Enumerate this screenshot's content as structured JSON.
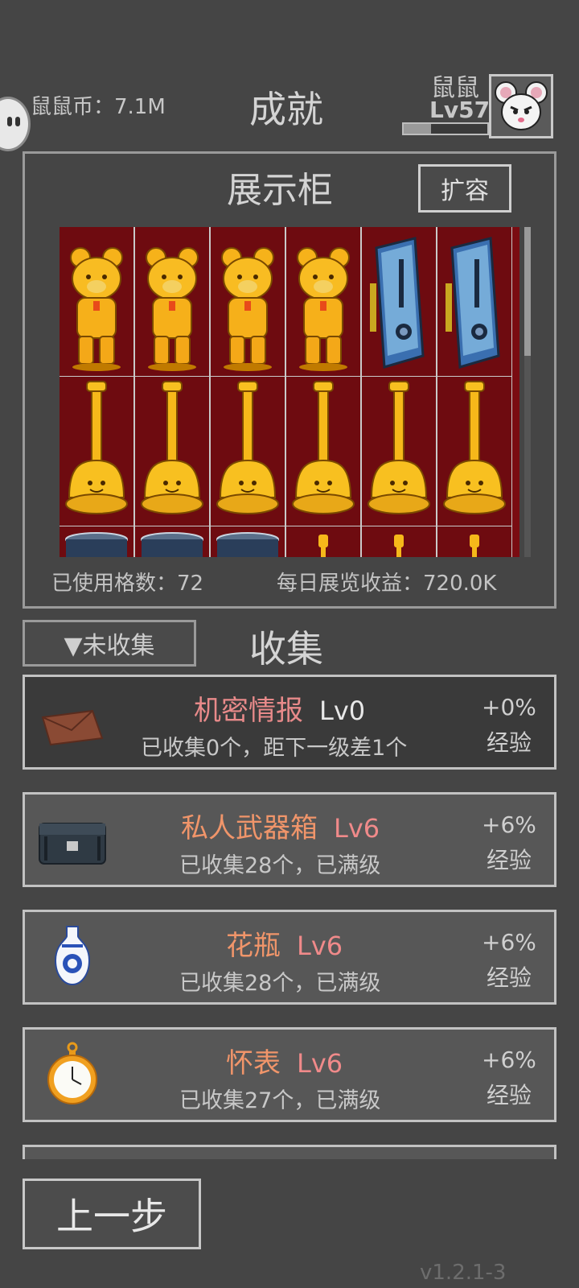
{
  "header": {
    "coins_label": "鼠鼠币：7.1M",
    "title": "成就",
    "player_name": "鼠鼠",
    "player_level": "Lv57",
    "xp_progress": 0.33
  },
  "showcase": {
    "title": "展示柜",
    "expand_label": "扩容",
    "used_slots_label": "已使用格数：72",
    "daily_income_label": "每日展览收益：720.0K",
    "grid_rows": [
      [
        "golden-bear-trophy",
        "golden-bear-trophy",
        "golden-bear-trophy",
        "golden-bear-trophy",
        "graphics-card",
        "graphics-card"
      ],
      [
        "golden-plunger-trophy",
        "golden-plunger-trophy",
        "golden-plunger-trophy",
        "golden-plunger-trophy",
        "golden-plunger-trophy",
        "golden-plunger-trophy"
      ],
      [
        "blue-pot",
        "blue-pot",
        "blue-pot",
        "golden-pin",
        "golden-pin",
        "golden-pin"
      ]
    ]
  },
  "collection": {
    "filter_label": "▼未收集",
    "title": "收集",
    "items": [
      {
        "name": "机密情报",
        "level": "Lv0",
        "desc": "已收集0个，距下一级差1个",
        "bonus": "+0%",
        "bonus_label": "经验",
        "icon": "envelope-icon",
        "name_color": "#e88a8a",
        "level_color": "#e8e8e8"
      },
      {
        "name": "私人武器箱",
        "level": "Lv6",
        "desc": "已收集28个，已满级",
        "bonus": "+6%",
        "bonus_label": "经验",
        "icon": "weapon-case-icon",
        "name_color": "#f0956a",
        "level_color": "#f08a8a"
      },
      {
        "name": "花瓶",
        "level": "Lv6",
        "desc": "已收集28个，已满级",
        "bonus": "+6%",
        "bonus_label": "经验",
        "icon": "vase-icon",
        "name_color": "#f0956a",
        "level_color": "#f08a8a"
      },
      {
        "name": "怀表",
        "level": "Lv6",
        "desc": "已收集27个，已满级",
        "bonus": "+6%",
        "bonus_label": "经验",
        "icon": "pocket-watch-icon",
        "name_color": "#f0956a",
        "level_color": "#f08a8a"
      }
    ]
  },
  "footer": {
    "back_label": "上一步",
    "version": "v1.2.1-3"
  }
}
